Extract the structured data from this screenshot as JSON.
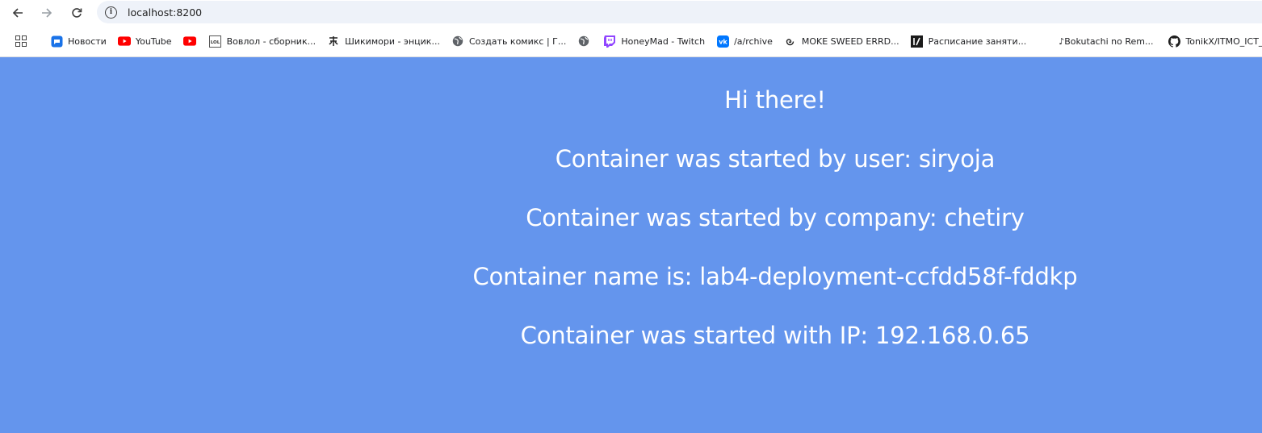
{
  "browser": {
    "url": "localhost:8200"
  },
  "bookmarks": [
    {
      "icon": "chat-icon",
      "label": "Новости",
      "color": "#1a73e8"
    },
    {
      "icon": "youtube-icon",
      "label": "YouTube",
      "color": "#ff0000"
    },
    {
      "icon": "youtube-icon",
      "label": "",
      "color": "#ff0000"
    },
    {
      "icon": "lol-icon",
      "label": "Вовлол - сборник..."
    },
    {
      "icon": "shikimori-icon",
      "label": "Шикимори - энцик..."
    },
    {
      "icon": "globe-icon",
      "label": "Создать комикс | Г..."
    },
    {
      "icon": "globe-icon",
      "label": ""
    },
    {
      "icon": "twitch-icon",
      "label": "HoneyMad - Twitch",
      "color": "#9146ff"
    },
    {
      "icon": "vk-icon",
      "label": "/a/rchive",
      "color": "#0077ff"
    },
    {
      "icon": "spiral-icon",
      "label": "MOKE SWEED ERRD..."
    },
    {
      "icon": "itmo-icon",
      "label": "Расписание заняти..."
    },
    {
      "icon": "",
      "label": "♪Bokutachi no Rem..."
    },
    {
      "icon": "github-icon",
      "label": "TonikX/ITMO_ICT_"
    }
  ],
  "page": {
    "background": "#6495ed",
    "greeting": "Hi there!",
    "user_line": "Container was started by user: siryoja",
    "company_line": "Container was started by company: chetiry",
    "name_line": "Container name is: lab4-deployment-ccfdd58f-fddkp",
    "ip_line": "Container was started with IP: 192.168.0.65"
  }
}
